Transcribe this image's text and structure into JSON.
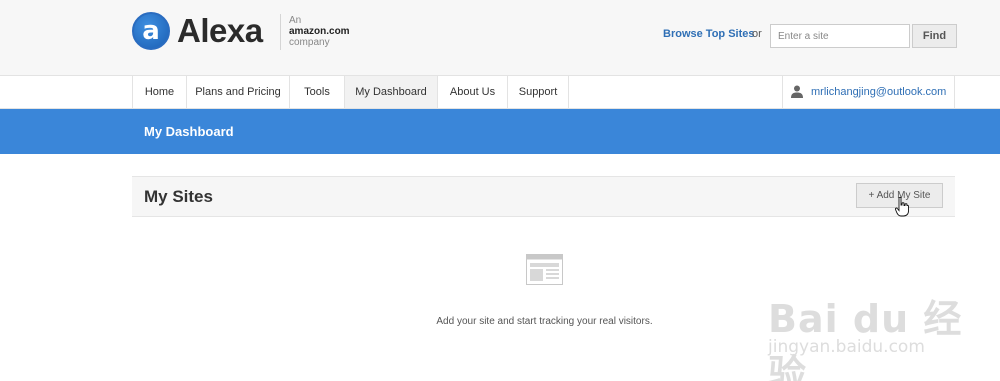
{
  "header": {
    "logo_letter": "a",
    "logo_text": "Alexa",
    "amazon_an": "An",
    "amazon_brand": "amazon.com",
    "amazon_company": "company",
    "browse_link": "Browse Top Sites",
    "or_text": "or",
    "site_input_placeholder": "Enter a site",
    "find_label": "Find"
  },
  "nav": {
    "items": [
      {
        "label": "Home"
      },
      {
        "label": "Plans and Pricing"
      },
      {
        "label": "Tools"
      },
      {
        "label": "My Dashboard"
      },
      {
        "label": "About Us"
      },
      {
        "label": "Support"
      }
    ],
    "active": "My Dashboard",
    "user_email": "mrlichangjing@outlook.com"
  },
  "banner": {
    "title": "My Dashboard"
  },
  "panel": {
    "title": "My Sites",
    "add_button": "+ Add My Site"
  },
  "empty_state": {
    "message": "Add your site and start tracking your real visitors."
  },
  "watermark": {
    "logo": "Bai du 经验",
    "url": "jingyan.baidu.com"
  },
  "colors": {
    "banner": "#3a86d9",
    "link": "#2f6fb5",
    "header_bg": "#f7f7f7"
  }
}
